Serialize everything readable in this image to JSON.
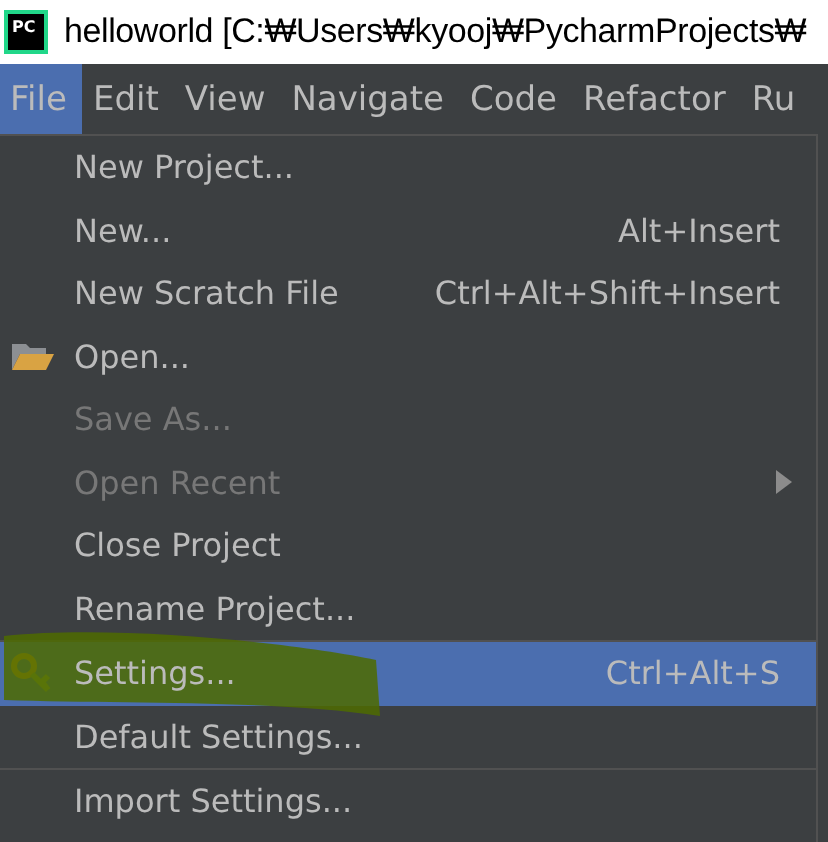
{
  "window": {
    "title": "helloworld [C:₩Users₩kyooj₩PycharmProjects₩",
    "app_icon": "PC"
  },
  "menu_bar": [
    {
      "label": "File",
      "selected": true
    },
    {
      "label": "Edit",
      "selected": false
    },
    {
      "label": "View",
      "selected": false
    },
    {
      "label": "Navigate",
      "selected": false
    },
    {
      "label": "Code",
      "selected": false
    },
    {
      "label": "Refactor",
      "selected": false
    },
    {
      "label": "Ru",
      "selected": false
    }
  ],
  "file_menu": [
    {
      "kind": "item",
      "label": "New Project...",
      "disabled": false,
      "selected": false
    },
    {
      "kind": "item",
      "label": "New...",
      "shortcut": "Alt+Insert",
      "disabled": false,
      "selected": false
    },
    {
      "kind": "item",
      "label": "New Scratch File",
      "shortcut": "Ctrl+Alt+Shift+Insert",
      "disabled": false,
      "selected": false
    },
    {
      "kind": "folder_item",
      "label": "Open...",
      "disabled": false,
      "selected": false
    },
    {
      "kind": "item",
      "label": "Save As...",
      "disabled": true,
      "selected": false
    },
    {
      "kind": "item",
      "label": "Open Recent",
      "submenu": true,
      "disabled": true,
      "selected": false
    },
    {
      "kind": "item",
      "label": "Close Project",
      "disabled": false,
      "selected": false
    },
    {
      "kind": "item",
      "label": "Rename Project...",
      "disabled": false,
      "selected": false
    },
    {
      "kind": "separator"
    },
    {
      "kind": "tool_item",
      "label": "Settings...",
      "shortcut": "Ctrl+Alt+S",
      "disabled": false,
      "selected": true
    },
    {
      "kind": "item",
      "label": "Default Settings...",
      "disabled": false,
      "selected": false
    },
    {
      "kind": "separator"
    },
    {
      "kind": "item",
      "label": "Import Settings...",
      "disabled": false,
      "selected": false
    }
  ]
}
